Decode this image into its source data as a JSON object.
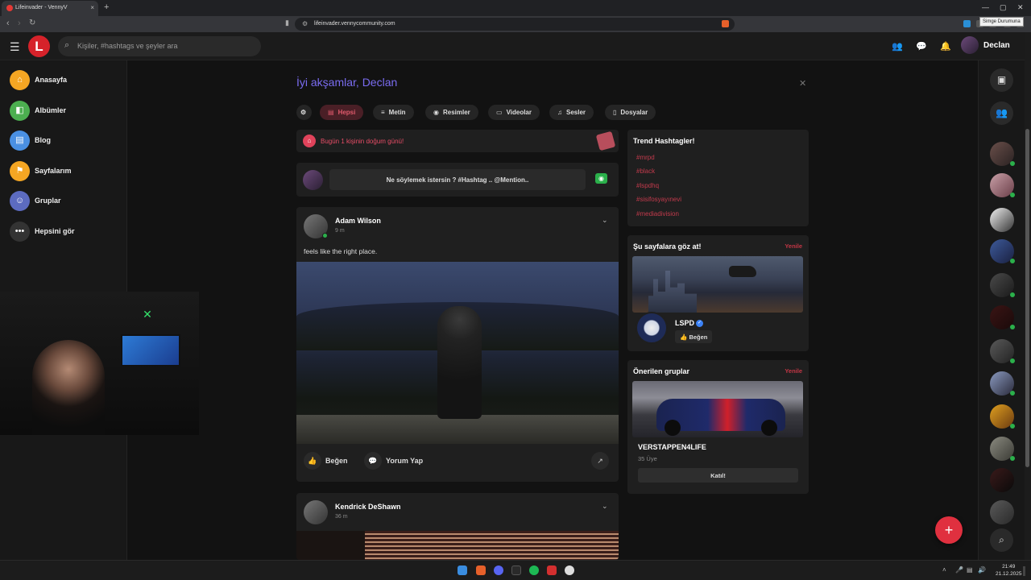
{
  "browser": {
    "tab_title": "Lifeinvader - VennyV",
    "tab_close": "×",
    "new_tab": "+",
    "url": "lifeinvader.vennycommunity.com",
    "tooltip": "Simge Durumuna",
    "window_minimize": "—",
    "window_maximize": "▢",
    "window_close": "✕"
  },
  "header": {
    "logo": "L",
    "search_placeholder": "Kişiler, #hashtags ve şeyler ara",
    "username": "Declan"
  },
  "sidebar": {
    "items": [
      {
        "label": "Anasayfa",
        "icon": "home-icon",
        "color": "#f5a623",
        "glyph": "⌂"
      },
      {
        "label": "Albümler",
        "icon": "album-icon",
        "color": "#4caf50",
        "glyph": "◧"
      },
      {
        "label": "Blog",
        "icon": "blog-icon",
        "color": "#4a90e2",
        "glyph": "▤"
      },
      {
        "label": "Sayfalarım",
        "icon": "flag-icon",
        "color": "#f5a623",
        "glyph": "⚑"
      },
      {
        "label": "Gruplar",
        "icon": "group-icon",
        "color": "#5c6bc0",
        "glyph": "☺"
      },
      {
        "label": "Hepsini gör",
        "icon": "more-icon",
        "color": "#333333",
        "glyph": "•••"
      }
    ]
  },
  "feed": {
    "greeting": "İyi akşamlar, Declan",
    "close": "✕",
    "filters": [
      {
        "label": "Hepsi",
        "glyph": "▤",
        "active": true
      },
      {
        "label": "Metin",
        "glyph": "≡",
        "active": false
      },
      {
        "label": "Resimler",
        "glyph": "◉",
        "active": false
      },
      {
        "label": "Videolar",
        "glyph": "▭",
        "active": false
      },
      {
        "label": "Sesler",
        "glyph": "♫",
        "active": false
      },
      {
        "label": "Dosyalar",
        "glyph": "▯",
        "active": false
      }
    ],
    "birthday_text": "Bugün 1 kişinin doğum günü!",
    "composer_placeholder": "Ne söylemek istersin ? #Hashtag .. @Mention..",
    "posts": [
      {
        "author": "Adam Wilson",
        "time": "9 m",
        "text": "feels like the right place.",
        "like": "Beğen",
        "comment": "Yorum Yap"
      },
      {
        "author": "Kendrick DeShawn",
        "time": "36 m"
      }
    ]
  },
  "trending": {
    "title": "Trend Hashtagler!",
    "hashtags": [
      "#mrpd",
      "#black",
      "#lspdhq",
      "#sisifosyayınevi",
      "#mediadivision"
    ]
  },
  "pages_card": {
    "title": "Şu sayfalara göz at!",
    "refresh": "Yenile",
    "page_name": "LSPD",
    "like": "Beğen"
  },
  "groups_card": {
    "title": "Önerilen gruplar",
    "refresh": "Yenile",
    "group_name": "VERSTAPPEN4LIFE",
    "members": "35 Üye",
    "join": "Katıl!"
  },
  "taskbar": {
    "time": "21:49",
    "date": "21.12.2025"
  },
  "colors": {
    "accent": "#e0303f",
    "greeting": "#7a6cf0",
    "hashtag": "#c23a4c",
    "online": "#2bb04b"
  }
}
